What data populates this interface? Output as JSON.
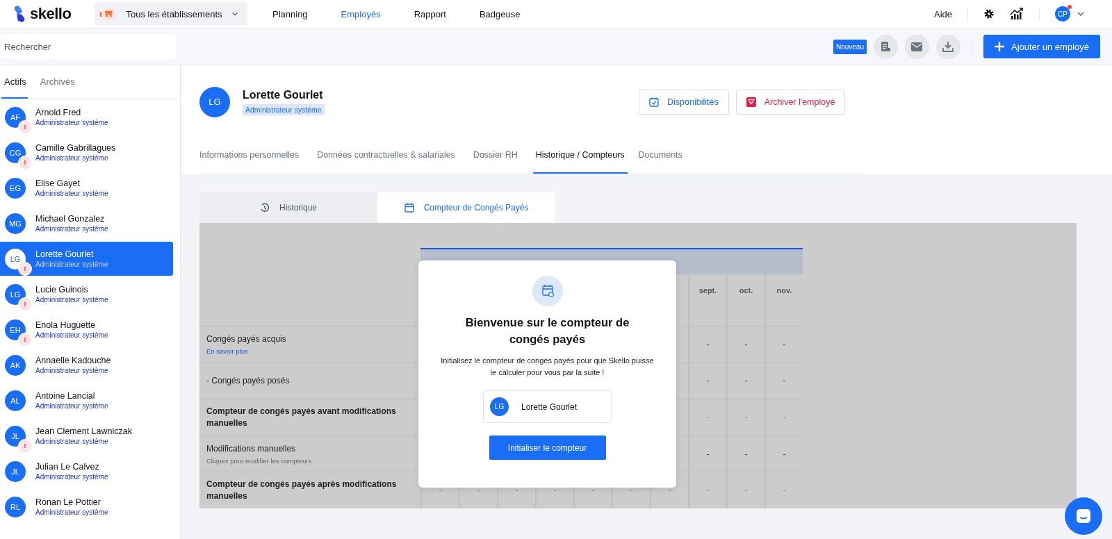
{
  "topbar": {
    "logo": "skello",
    "location_select": "Tous les établissements",
    "nav": [
      {
        "label": "Planning",
        "selected": false
      },
      {
        "label": "Employés",
        "selected": true
      },
      {
        "label": "Rapport",
        "selected": false
      },
      {
        "label": "Badgeuse",
        "selected": false
      }
    ],
    "help": "Aide",
    "user_initials": "CP",
    "notification": true
  },
  "toolbar": {
    "search": {
      "placeholder": "Rechercher"
    },
    "badge": "Nouveau",
    "add_button": "Ajouter un employé"
  },
  "sidebar": {
    "tabs": [
      {
        "label": "Actifs",
        "selected": true
      },
      {
        "label": "Archivés",
        "selected": false
      }
    ],
    "employees": [
      {
        "initials": "AF",
        "name": "Arnold Fred",
        "role": "Administrateur système",
        "alert": "!",
        "selected": false
      },
      {
        "initials": "CG",
        "name": "Camille Gabrillagues",
        "role": "Administrateur système",
        "alert": "!",
        "selected": false
      },
      {
        "initials": "EG",
        "name": "Elise Gayet",
        "role": "Administrateur système",
        "selected": false
      },
      {
        "initials": "MG",
        "name": "Michael Gonzalez",
        "role": "Administrateur système",
        "selected": false
      },
      {
        "initials": "LG",
        "name": "Lorette Gourlet",
        "role": "Administrateur système",
        "alert": "!",
        "selected": true
      },
      {
        "initials": "LG",
        "name": "Lucie Guinois",
        "role": "Administrateur système",
        "alert": "!",
        "selected": false
      },
      {
        "initials": "EH",
        "name": "Enola Huguette",
        "role": "Administrateur système",
        "alert": "!",
        "selected": false
      },
      {
        "initials": "AK",
        "name": "Annaelle Kadouche",
        "role": "Administrateur système",
        "selected": false
      },
      {
        "initials": "AL",
        "name": "Antoine Lancial",
        "role": "Administrateur système",
        "selected": false
      },
      {
        "initials": "JL",
        "name": "Jean Clement Lawniczak",
        "role": "Administrateur système",
        "alert": "!",
        "selected": false
      },
      {
        "initials": "JL",
        "name": "Julian Le Calvez",
        "role": "Administrateur système",
        "selected": false
      },
      {
        "initials": "RL",
        "name": "Ronan Le Pottier",
        "role": "Administrateur système",
        "selected": false
      }
    ]
  },
  "employee": {
    "initials": "LG",
    "name": "Lorette Gourlet",
    "role": "Administrateur système",
    "buttons": [
      {
        "kind": "availability",
        "label": "Disponibilités"
      },
      {
        "kind": "archive",
        "label": "Archiver l'employé"
      }
    ]
  },
  "tabs": [
    {
      "label": "Informations personnelles",
      "selected": false
    },
    {
      "label": "Données contractuelles & salariales",
      "selected": false
    },
    {
      "label": "Dossier RH",
      "selected": false
    },
    {
      "label": "Historique / Compteurs",
      "selected": true
    },
    {
      "label": "Documents",
      "selected": false
    }
  ],
  "subtabs": [
    {
      "kind": "history",
      "label": "Historique",
      "selected": false
    },
    {
      "kind": "counter",
      "label": "Compteur de Congés Payés",
      "selected": true
    }
  ],
  "table": {
    "columns": [
      {},
      {},
      {},
      {},
      {},
      {},
      {},
      {
        "label": "sept."
      },
      {
        "label": "oct."
      },
      {
        "label": "nov."
      }
    ],
    "rows": [
      {
        "kind": "plain",
        "label": "Congés payés acquis",
        "link": "En savoir plus",
        "cells": [
          null,
          null,
          null,
          null,
          null,
          null,
          null,
          "-",
          "-",
          "-"
        ]
      },
      {
        "kind": "plain",
        "label": "- Congés payés posés",
        "cells": [
          null,
          null,
          null,
          null,
          null,
          null,
          null,
          "-",
          "-",
          "-"
        ]
      },
      {
        "kind": "total",
        "label": "Compteur de congés payés avant modifications manuelles",
        "cells": [
          null,
          null,
          null,
          null,
          null,
          null,
          null,
          "-",
          "-",
          "-"
        ]
      },
      {
        "kind": "plain",
        "label": "Modifications manuelles",
        "hint": "Cliquez pour modifier les compteurs",
        "cells": [
          null,
          null,
          null,
          null,
          null,
          null,
          null,
          "-",
          "-",
          "-"
        ]
      },
      {
        "kind": "total",
        "label": "Compteur de congés payés après modifications manuelles",
        "cells": [
          "-",
          "-",
          "-",
          "-",
          "-",
          "-",
          "-",
          "-",
          "-",
          "-"
        ]
      }
    ]
  },
  "modal": {
    "title": "Bienvenue sur le compteur de congés payés",
    "text": "Initialisez le compteur de congés payés pour que Skello puisse le calculer pour vous par la suite !",
    "employee": {
      "initials": "LG",
      "name": "Lorette Gourlet"
    },
    "button": "Initialiser le compteur"
  }
}
